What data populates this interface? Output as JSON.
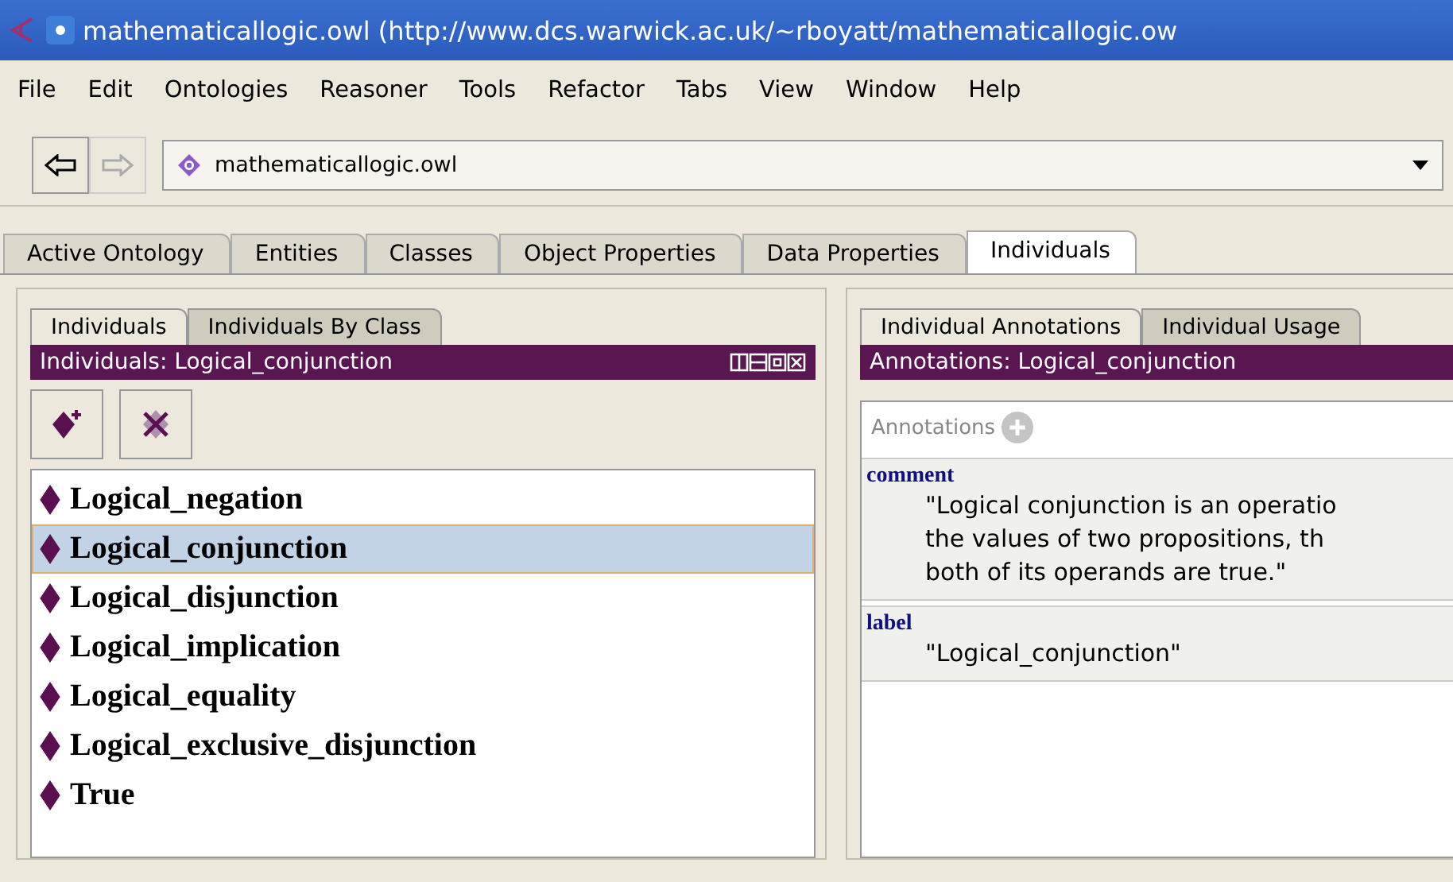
{
  "window": {
    "title": "mathematicallogic.owl (http://www.dcs.warwick.ac.uk/~rboyatt/mathematicallogic.ow"
  },
  "menu": [
    "File",
    "Edit",
    "Ontologies",
    "Reasoner",
    "Tools",
    "Refactor",
    "Tabs",
    "View",
    "Window",
    "Help"
  ],
  "toolbar": {
    "back_disabled": false,
    "forward_disabled": true,
    "ontology": "mathematicallogic.owl"
  },
  "tabs": [
    {
      "label": "Active Ontology",
      "selected": false
    },
    {
      "label": "Entities",
      "selected": false
    },
    {
      "label": "Classes",
      "selected": false
    },
    {
      "label": "Object Properties",
      "selected": false
    },
    {
      "label": "Data Properties",
      "selected": false
    },
    {
      "label": "Individuals",
      "selected": true
    }
  ],
  "left": {
    "tabs": [
      {
        "label": "Individuals",
        "selected": true
      },
      {
        "label": "Individuals By Class",
        "selected": false
      }
    ],
    "header": "Individuals: Logical_conjunction",
    "items": [
      {
        "label": "Logical_negation",
        "selected": false
      },
      {
        "label": "Logical_conjunction",
        "selected": true
      },
      {
        "label": "Logical_disjunction",
        "selected": false
      },
      {
        "label": "Logical_implication",
        "selected": false
      },
      {
        "label": "Logical_equality",
        "selected": false
      },
      {
        "label": "Logical_exclusive_disjunction",
        "selected": false
      },
      {
        "label": "True",
        "selected": false
      }
    ]
  },
  "right": {
    "tabs": [
      {
        "label": "Individual Annotations",
        "selected": true
      },
      {
        "label": "Individual Usage",
        "selected": false
      }
    ],
    "header": "Annotations: Logical_conjunction",
    "section": "Annotations",
    "annotations": [
      {
        "property": "comment",
        "lines": [
          "\"Logical conjunction is an operatio",
          "the values of two propositions, th",
          "both of its operands are true.\""
        ]
      },
      {
        "property": "label",
        "lines": [
          "\"Logical_conjunction\""
        ]
      }
    ]
  }
}
